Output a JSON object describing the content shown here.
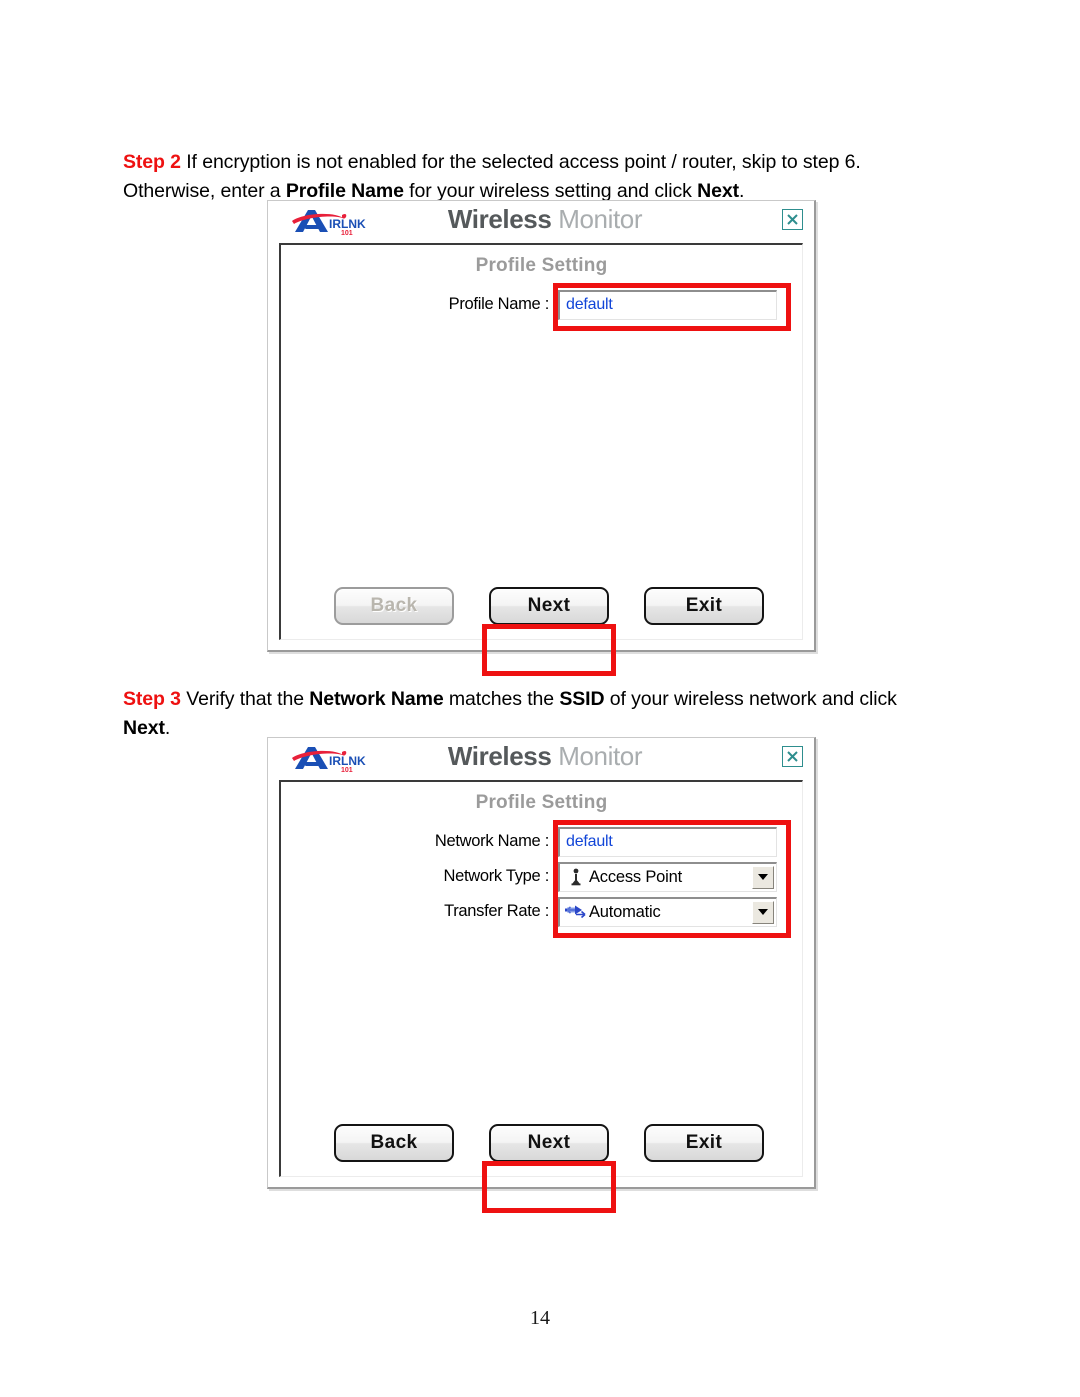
{
  "document": {
    "page_number": "14"
  },
  "steps": [
    {
      "label": "Step 2",
      "segments": [
        {
          "text": " If encryption is not enabled for the selected access point / router, skip to step 6. Otherwise, enter a ",
          "bold": false
        },
        {
          "text": "Profile Name",
          "bold": true
        },
        {
          "text": " for your wireless setting and click ",
          "bold": false
        },
        {
          "text": "Next",
          "bold": true
        },
        {
          "text": ".",
          "bold": false
        }
      ]
    },
    {
      "label": "Step 3",
      "segments": [
        {
          "text": " Verify that the ",
          "bold": false
        },
        {
          "text": "Network Name",
          "bold": true
        },
        {
          "text": " matches the ",
          "bold": false
        },
        {
          "text": "SSID",
          "bold": true
        },
        {
          "text": " of your wireless network and click ",
          "bold": false
        },
        {
          "text": "Next",
          "bold": true
        },
        {
          "text": ".",
          "bold": false
        }
      ]
    }
  ],
  "dialog1": {
    "title_bold": "Wireless",
    "title_light": " Monitor",
    "logo_alt": "AirLink 101",
    "close_icon": "close-icon",
    "panel_heading": "Profile Setting",
    "fields": [
      {
        "label": "Profile Name :",
        "value": "default",
        "type": "text"
      }
    ],
    "buttons": {
      "back": "Back",
      "next": "Next",
      "exit": "Exit"
    }
  },
  "dialog2": {
    "title_bold": "Wireless",
    "title_light": " Monitor",
    "logo_alt": "AirLink 101",
    "close_icon": "close-icon",
    "panel_heading": "Profile Setting",
    "fields": [
      {
        "label": "Network Name :",
        "value": "default",
        "type": "text"
      },
      {
        "label": "Network Type :",
        "value": "Access Point",
        "type": "combo",
        "icon": "access-point-icon"
      },
      {
        "label": "Transfer Rate :",
        "value": "Automatic",
        "type": "combo",
        "icon": "transfer-rate-icon"
      }
    ],
    "buttons": {
      "back": "Back",
      "next": "Next",
      "exit": "Exit"
    }
  },
  "colors": {
    "step_label": "#ee1111",
    "highlight": "#ee1111",
    "field_value": "#1145d8",
    "title_bold": "#55595b",
    "title_light": "#a9adaf",
    "panel_heading": "#9b9b9b",
    "close_border": "#2e8e8e"
  }
}
